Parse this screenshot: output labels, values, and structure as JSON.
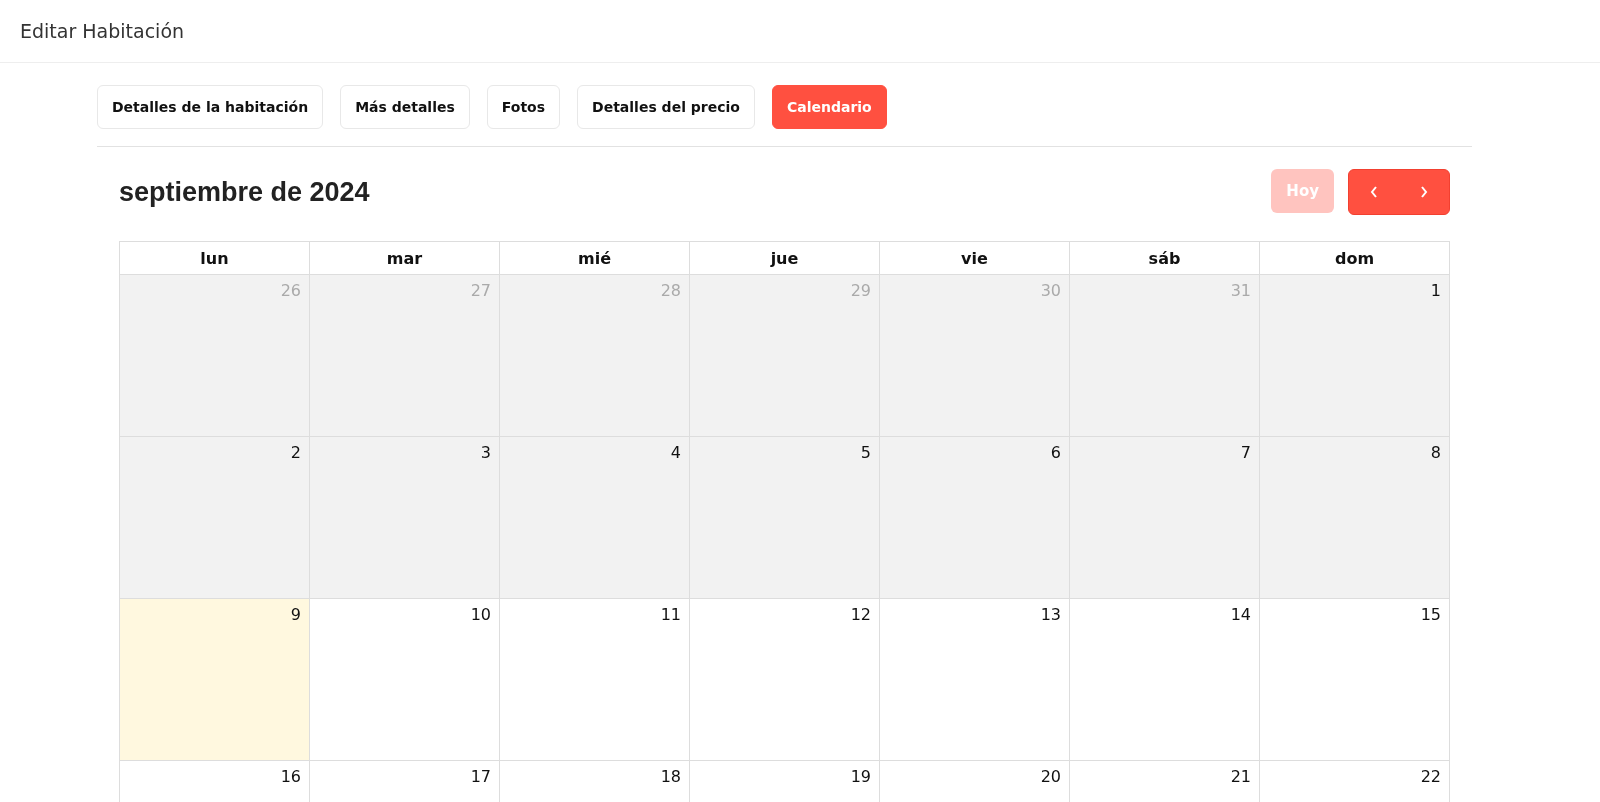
{
  "header": {
    "title": "Editar Habitación"
  },
  "tabs": [
    {
      "label": "Detalles de la habitación",
      "selected": false
    },
    {
      "label": "Más detalles",
      "selected": false
    },
    {
      "label": "Fotos",
      "selected": false
    },
    {
      "label": "Detalles del precio",
      "selected": false
    },
    {
      "label": "Calendario",
      "selected": true
    }
  ],
  "calendar": {
    "title": "septiembre de 2024",
    "today_button": {
      "label": "Hoy",
      "disabled": true
    },
    "weekdays": [
      "lun",
      "mar",
      "mié",
      "jue",
      "vie",
      "sáb",
      "dom"
    ],
    "weeks": [
      [
        {
          "number": "26",
          "outside": true,
          "past": true,
          "today": false
        },
        {
          "number": "27",
          "outside": true,
          "past": true,
          "today": false
        },
        {
          "number": "28",
          "outside": true,
          "past": true,
          "today": false
        },
        {
          "number": "29",
          "outside": true,
          "past": true,
          "today": false
        },
        {
          "number": "30",
          "outside": true,
          "past": true,
          "today": false
        },
        {
          "number": "31",
          "outside": true,
          "past": true,
          "today": false
        },
        {
          "number": "1",
          "outside": false,
          "past": true,
          "today": false
        }
      ],
      [
        {
          "number": "2",
          "outside": false,
          "past": true,
          "today": false
        },
        {
          "number": "3",
          "outside": false,
          "past": true,
          "today": false
        },
        {
          "number": "4",
          "outside": false,
          "past": true,
          "today": false
        },
        {
          "number": "5",
          "outside": false,
          "past": true,
          "today": false
        },
        {
          "number": "6",
          "outside": false,
          "past": true,
          "today": false
        },
        {
          "number": "7",
          "outside": false,
          "past": true,
          "today": false
        },
        {
          "number": "8",
          "outside": false,
          "past": true,
          "today": false
        }
      ],
      [
        {
          "number": "9",
          "outside": false,
          "past": false,
          "today": true
        },
        {
          "number": "10",
          "outside": false,
          "past": false,
          "today": false
        },
        {
          "number": "11",
          "outside": false,
          "past": false,
          "today": false
        },
        {
          "number": "12",
          "outside": false,
          "past": false,
          "today": false
        },
        {
          "number": "13",
          "outside": false,
          "past": false,
          "today": false
        },
        {
          "number": "14",
          "outside": false,
          "past": false,
          "today": false
        },
        {
          "number": "15",
          "outside": false,
          "past": false,
          "today": false
        }
      ],
      [
        {
          "number": "16",
          "outside": false,
          "past": false,
          "today": false
        },
        {
          "number": "17",
          "outside": false,
          "past": false,
          "today": false
        },
        {
          "number": "18",
          "outside": false,
          "past": false,
          "today": false
        },
        {
          "number": "19",
          "outside": false,
          "past": false,
          "today": false
        },
        {
          "number": "20",
          "outside": false,
          "past": false,
          "today": false
        },
        {
          "number": "21",
          "outside": false,
          "past": false,
          "today": false
        },
        {
          "number": "22",
          "outside": false,
          "past": false,
          "today": false
        }
      ]
    ]
  }
}
